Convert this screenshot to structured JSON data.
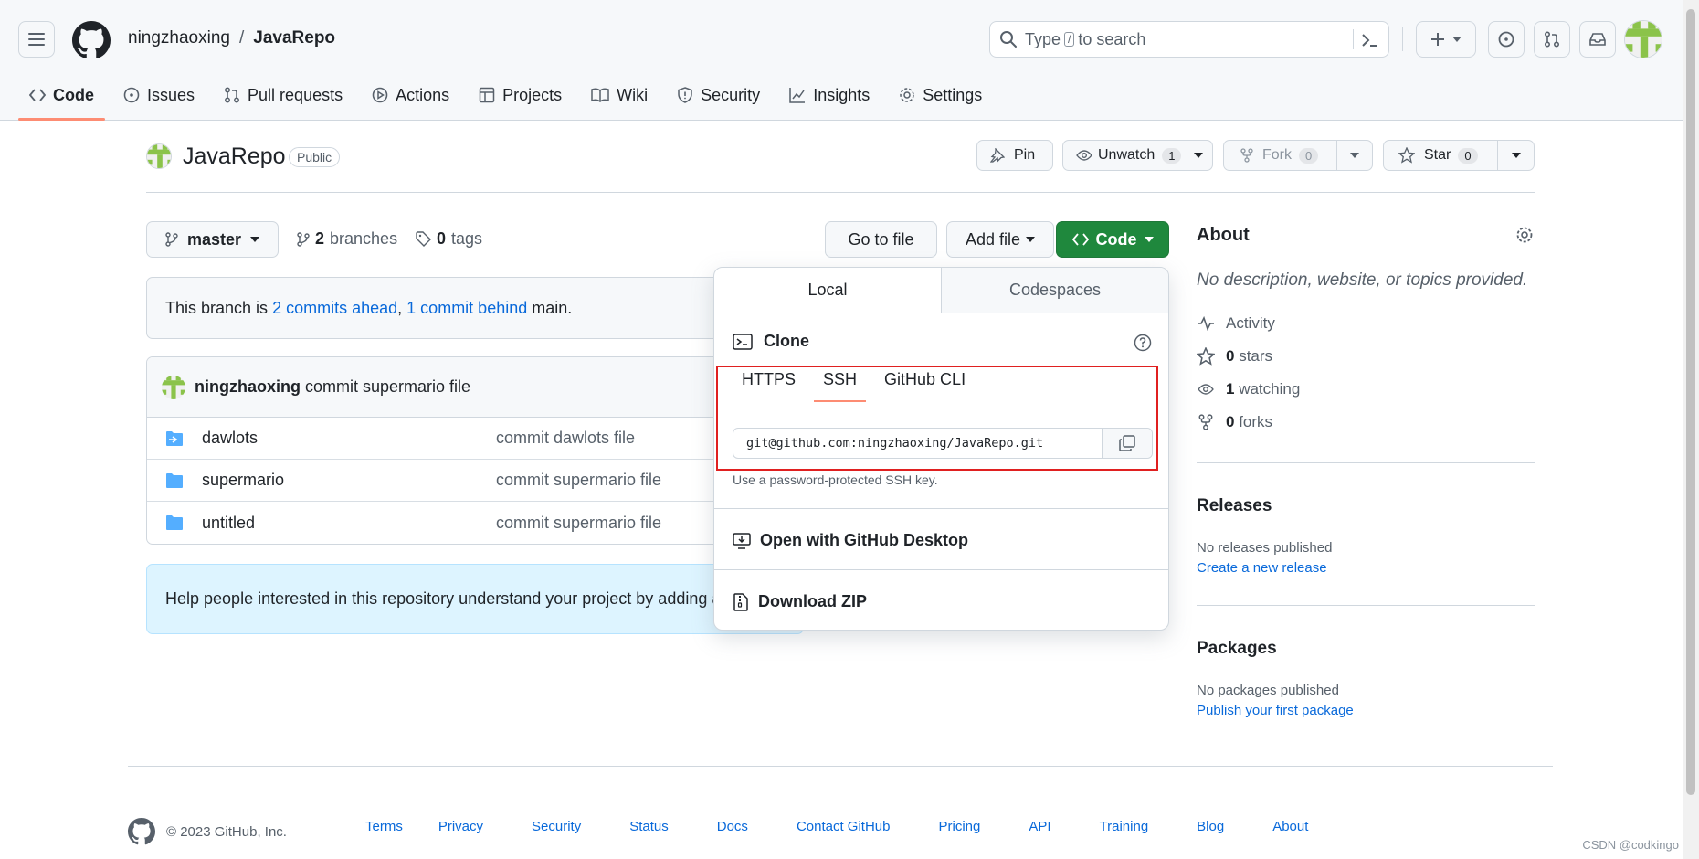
{
  "header": {
    "owner": "ningzhaoxing",
    "separator": "/",
    "repo": "JavaRepo",
    "search_pre": "Type",
    "search_key": "/",
    "search_post": "to search"
  },
  "repo_nav": [
    {
      "label": "Code",
      "icon": "code-icon"
    },
    {
      "label": "Issues",
      "icon": "issue-icon"
    },
    {
      "label": "Pull requests",
      "icon": "pull-request-icon"
    },
    {
      "label": "Actions",
      "icon": "play-icon"
    },
    {
      "label": "Projects",
      "icon": "table-icon"
    },
    {
      "label": "Wiki",
      "icon": "book-icon"
    },
    {
      "label": "Security",
      "icon": "shield-icon"
    },
    {
      "label": "Insights",
      "icon": "graph-icon"
    },
    {
      "label": "Settings",
      "icon": "gear-icon"
    }
  ],
  "repo_title": {
    "name": "JavaRepo",
    "visibility": "Public",
    "pin": "Pin",
    "unwatch": "Unwatch",
    "watch_count": "1",
    "fork": "Fork",
    "fork_count": "0",
    "star": "Star",
    "star_count": "0"
  },
  "toolbar": {
    "branch": "master",
    "branches_count": "2",
    "branches_label": "branches",
    "tags_count": "0",
    "tags_label": "tags",
    "go_to_file": "Go to file",
    "add_file": "Add file",
    "code": "Code"
  },
  "branch_info": {
    "prefix": "This branch is",
    "ahead": "2 commits ahead",
    "comma": ",",
    "behind": "1 commit behind",
    "suffix": "main."
  },
  "latest_commit": {
    "author": "ningzhaoxing",
    "message": "commit supermario file"
  },
  "files": [
    {
      "name": "dawlots",
      "message": "commit dawlots file",
      "icon": "folder-submodule-icon"
    },
    {
      "name": "supermario",
      "message": "commit supermario file",
      "icon": "folder-icon"
    },
    {
      "name": "untitled",
      "message": "commit supermario file",
      "icon": "folder-icon"
    }
  ],
  "readme_prompt": "Help people interested in this repository understand your project by adding a",
  "code_panel": {
    "tab_local": "Local",
    "tab_codespaces": "Codespaces",
    "clone_title": "Clone",
    "protocols": [
      "HTTPS",
      "SSH",
      "GitHub CLI"
    ],
    "active_protocol": "SSH",
    "clone_url": "git@github.com:ningzhaoxing/JavaRepo.git",
    "hint": "Use a password-protected SSH key.",
    "open_desktop": "Open with GitHub Desktop",
    "download_zip": "Download ZIP"
  },
  "sidebar": {
    "about_title": "About",
    "description": "No description, website, or topics provided.",
    "activity": "Activity",
    "stars_count": "0",
    "stars_label": "stars",
    "watching_count": "1",
    "watching_label": "watching",
    "forks_count": "0",
    "forks_label": "forks",
    "releases_title": "Releases",
    "releases_empty": "No releases published",
    "releases_link": "Create a new release",
    "packages_title": "Packages",
    "packages_empty": "No packages published",
    "packages_link": "Publish your first package"
  },
  "footer": {
    "copyright": "© 2023 GitHub, Inc.",
    "links": [
      "Terms",
      "Privacy",
      "Security",
      "Status",
      "Docs",
      "Contact GitHub",
      "Pricing",
      "API",
      "Training",
      "Blog",
      "About"
    ]
  },
  "watermark": "CSDN @codkingo",
  "colors": {
    "primary_button": "#1f883d",
    "link": "#0969da",
    "tab_underline": "#fd8c73",
    "highlight_box": "#e02020",
    "avatar_green": "#8bc34a"
  }
}
